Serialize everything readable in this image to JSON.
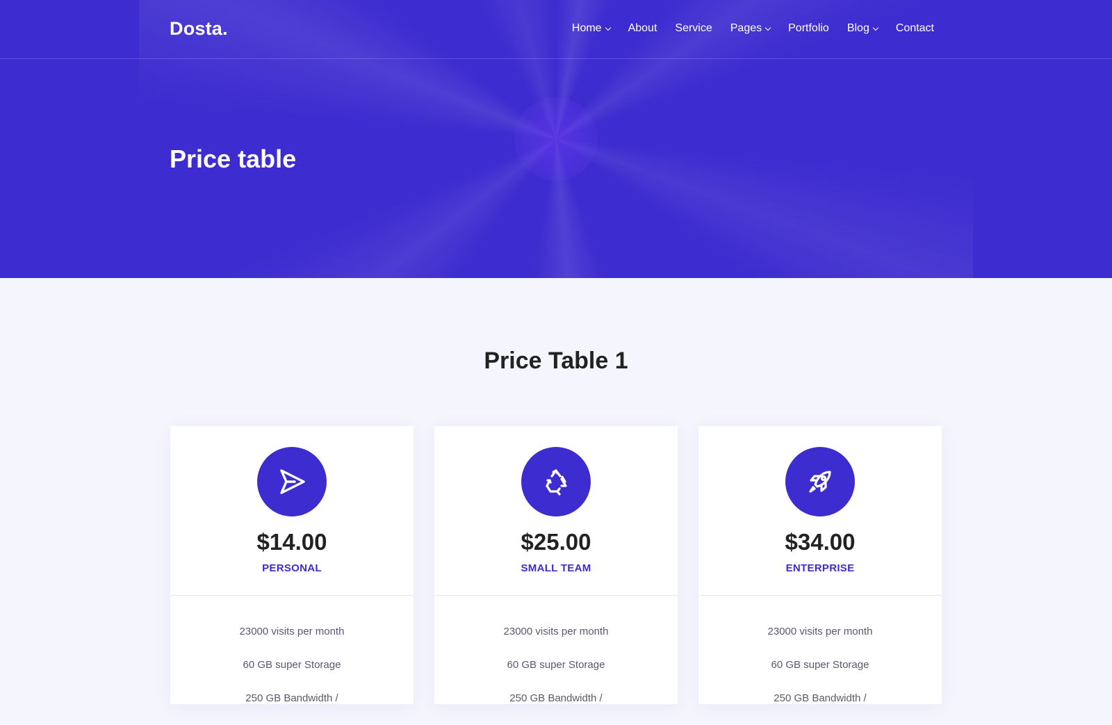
{
  "brand": {
    "logo": "Dosta."
  },
  "nav": {
    "items": [
      {
        "label": "Home",
        "dropdown": true
      },
      {
        "label": "About",
        "dropdown": false
      },
      {
        "label": "Service",
        "dropdown": false
      },
      {
        "label": "Pages",
        "dropdown": true
      },
      {
        "label": "Portfolio",
        "dropdown": false
      },
      {
        "label": "Blog",
        "dropdown": true
      },
      {
        "label": "Contact",
        "dropdown": false
      }
    ]
  },
  "hero": {
    "title": "Price table"
  },
  "section": {
    "title": "Price Table 1"
  },
  "colors": {
    "accent": "#3d2ccf",
    "page_bg": "#f5f5fd"
  },
  "plans": [
    {
      "icon": "send-icon",
      "price": "$14.00",
      "name": "PERSONAL",
      "features": [
        "23000 visits per month",
        "60 GB super Storage",
        "250 GB Bandwidth /"
      ]
    },
    {
      "icon": "recycle-icon",
      "price": "$25.00",
      "name": "SMALL TEAM",
      "features": [
        "23000 visits per month",
        "60 GB super Storage",
        "250 GB Bandwidth /"
      ]
    },
    {
      "icon": "rocket-icon",
      "price": "$34.00",
      "name": "ENTERPRISE",
      "features": [
        "23000 visits per month",
        "60 GB super Storage",
        "250 GB Bandwidth /"
      ]
    }
  ]
}
